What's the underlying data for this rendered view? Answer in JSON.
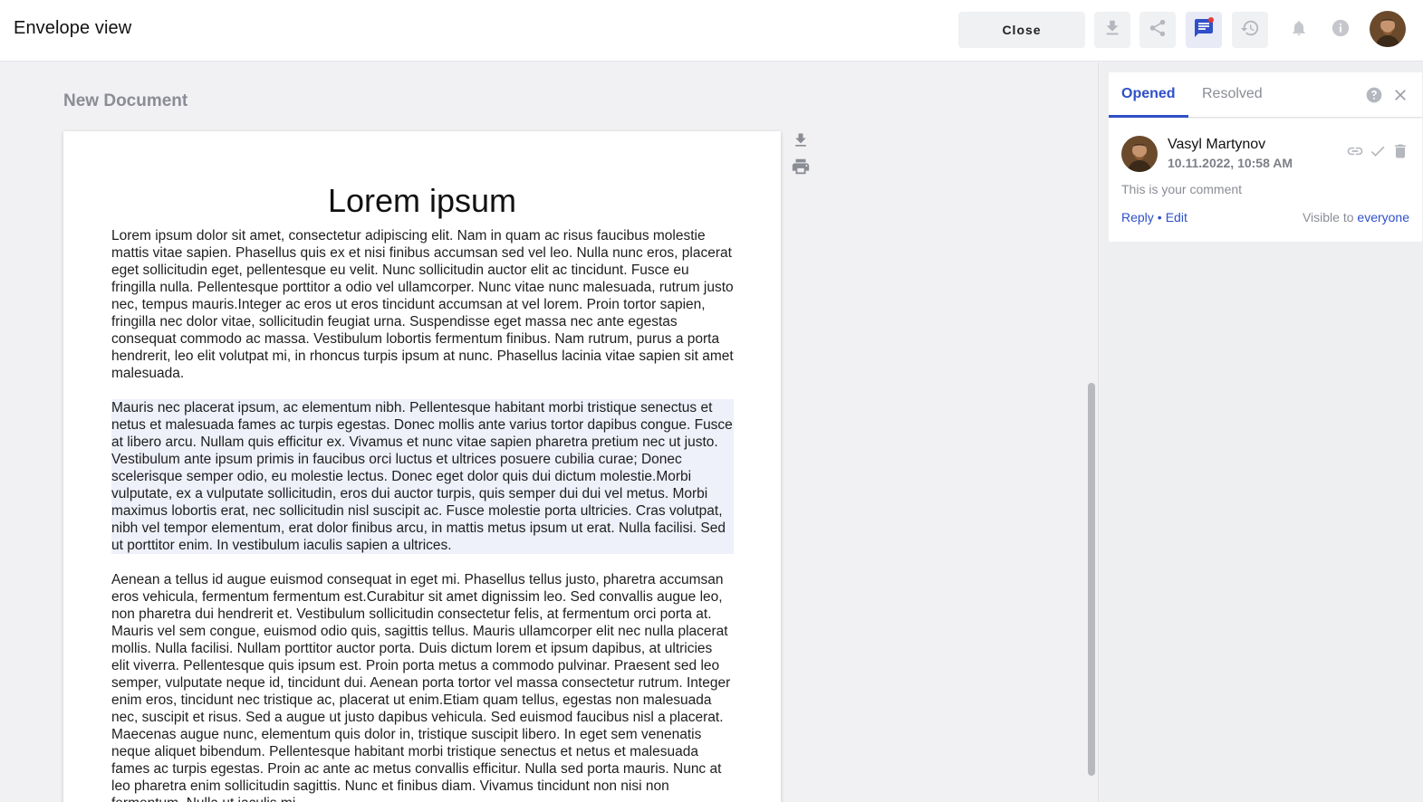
{
  "header": {
    "title": "Envelope view",
    "close_label": "Close",
    "icons": [
      "download-icon",
      "share-icon",
      "comments-icon",
      "history-icon",
      "bell-icon",
      "info-icon"
    ]
  },
  "document": {
    "name": "New Document",
    "title": "Lorem ipsum",
    "paragraphs": [
      "Lorem ipsum dolor sit amet, consectetur adipiscing elit. Nam in quam ac risus faucibus molestie mattis vitae sapien. Phasellus quis ex et nisi finibus accumsan sed vel leo. Nulla nunc eros, placerat eget sollicitudin eget, pellentesque eu velit. Nunc sollicitudin auctor elit ac tincidunt. Fusce eu fringilla nulla. Pellentesque porttitor a odio vel ullamcorper. Nunc vitae nunc malesuada, rutrum justo nec, tempus mauris.Integer ac eros ut eros tincidunt accumsan at vel lorem. Proin tortor sapien, fringilla nec dolor vitae, sollicitudin feugiat urna. Suspendisse eget massa nec ante egestas consequat commodo ac massa. Vestibulum lobortis fermentum finibus. Nam rutrum, purus a porta hendrerit, leo elit volutpat mi, in rhoncus turpis ipsum at nunc. Phasellus lacinia vitae sapien sit amet malesuada.",
      "Mauris nec placerat ipsum, ac elementum nibh. Pellentesque habitant morbi tristique senectus et netus et malesuada fames ac turpis egestas. Donec mollis ante varius tortor dapibus congue. Fusce at libero arcu. Nullam quis efficitur ex. Vivamus et nunc vitae sapien pharetra pretium nec ut justo. Vestibulum ante ipsum primis in faucibus orci luctus et ultrices posuere cubilia curae; Donec scelerisque semper odio, eu molestie lectus. Donec eget dolor quis dui dictum molestie.Morbi vulputate, ex a vulputate sollicitudin, eros dui auctor turpis, quis semper dui dui vel metus. Morbi maximus lobortis erat, nec sollicitudin nisl suscipit ac. Fusce molestie porta ultricies. Cras volutpat, nibh vel tempor elementum, erat dolor finibus arcu, in mattis metus ipsum ut erat. Nulla facilisi. Sed ut porttitor enim. In vestibulum iaculis sapien a ultrices.",
      "Aenean a tellus id augue euismod consequat in eget mi. Phasellus tellus justo, pharetra accumsan eros vehicula, fermentum fermentum est.Curabitur sit amet dignissim leo. Sed convallis augue leo, non pharetra dui hendrerit et. Vestibulum sollicitudin consectetur felis, at fermentum orci porta at. Mauris vel sem congue, euismod odio quis, sagittis tellus. Mauris ullamcorper elit nec nulla placerat mollis. Nulla facilisi. Nullam porttitor auctor porta. Duis dictum lorem et ipsum dapibus, at ultricies elit viverra. Pellentesque quis ipsum est. Proin porta metus a commodo pulvinar. Praesent sed leo semper, vulputate neque id, tincidunt dui. Aenean porta tortor vel massa consectetur rutrum. Integer enim eros, tincidunt nec tristique ac, placerat ut enim.Etiam quam tellus, egestas non malesuada nec, suscipit et risus. Sed a augue ut justo dapibus vehicula. Sed euismod faucibus nisl a placerat. Maecenas augue nunc, elementum quis dolor in, tristique suscipit libero. In eget sem venenatis neque aliquet bibendum. Pellentesque habitant morbi tristique senectus et netus et malesuada fames ac turpis egestas. Proin ac ante ac metus convallis efficitur. Nulla sed porta mauris. Nunc at leo pharetra enim sollicitudin sagittis. Nunc et finibus diam. Vivamus tincidunt non nisi non fermentum. Nulla ut iaculis mi."
    ]
  },
  "comments_panel": {
    "tabs": [
      {
        "label": "Opened",
        "active": true
      },
      {
        "label": "Resolved",
        "active": false
      }
    ],
    "comment": {
      "author": "Vasyl Martynov",
      "date": "10.11.2022, 10:58 AM",
      "text": "This is your comment",
      "reply_label": "Reply",
      "edit_label": "Edit",
      "visible_prefix": "Visible to",
      "visible_audience": "everyone"
    }
  },
  "colors": {
    "accent": "#2f50c8",
    "highlight": "#eef0fa"
  }
}
